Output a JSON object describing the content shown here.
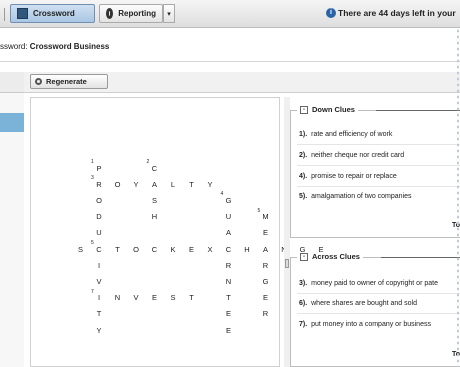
{
  "toolbar": {
    "tabs": [
      {
        "label": "Crossword",
        "icon": "crossword-grid-icon"
      },
      {
        "label": "Reporting",
        "icon": "reporting-gear-icon"
      }
    ],
    "dropdown_glyph": "▾",
    "trial_notice": "There are 44 days left in your"
  },
  "crossword": {
    "title_label": "ssword:",
    "title_value": "Crossword Business",
    "regenerate_label": "Regenerate"
  },
  "grid": {
    "cells": [
      {
        "c": "P",
        "n": "1"
      },
      {
        "c": "R",
        "n": "3"
      },
      {
        "c": "O"
      },
      {
        "c": "D"
      },
      {
        "c": "U"
      },
      {
        "c": "C",
        "n": "5"
      },
      {
        "c": "I"
      },
      {
        "c": "V"
      },
      {
        "c": "I",
        "n": "7"
      },
      {
        "c": "T"
      },
      {
        "c": "Y"
      },
      {
        "c": "O"
      },
      {
        "c": "Y"
      },
      {
        "c": "A"
      },
      {
        "c": "L"
      },
      {
        "c": "T"
      },
      {
        "c": "Y"
      },
      {
        "c": "C",
        "n": "2"
      },
      {
        "c": "S"
      },
      {
        "c": "H"
      },
      {
        "c": "S"
      },
      {
        "c": "T"
      },
      {
        "c": "O"
      },
      {
        "c": "C"
      },
      {
        "c": "K"
      },
      {
        "c": "E"
      },
      {
        "c": "X"
      },
      {
        "c": "C"
      },
      {
        "c": "H"
      },
      {
        "c": "A"
      },
      {
        "c": "N"
      },
      {
        "c": "G"
      },
      {
        "c": "E"
      },
      {
        "c": "G",
        "n": "4"
      },
      {
        "c": "U"
      },
      {
        "c": "A"
      },
      {
        "c": "R"
      },
      {
        "c": "N"
      },
      {
        "c": "T"
      },
      {
        "c": "E"
      },
      {
        "c": "E"
      },
      {
        "c": "M",
        "n": "5"
      },
      {
        "c": "E"
      },
      {
        "c": "R"
      },
      {
        "c": "G"
      },
      {
        "c": "E"
      },
      {
        "c": "R"
      },
      {
        "c": "N"
      },
      {
        "c": "V"
      },
      {
        "c": "E"
      },
      {
        "c": "S"
      },
      {
        "c": "T"
      }
    ]
  },
  "down_clues": {
    "heading": "Down Clues",
    "items": [
      {
        "num": "1).",
        "text": "rate and efficiency of work"
      },
      {
        "num": "2).",
        "text": "neither cheque nor credit card"
      },
      {
        "num": "4).",
        "text": "promise to repair or replace"
      },
      {
        "num": "5).",
        "text": "amalgamation of two companies"
      }
    ],
    "footer": "To"
  },
  "across_clues": {
    "heading": "Across Clues",
    "items": [
      {
        "num": "3).",
        "text": "money paid to owner of copyright or pate"
      },
      {
        "num": "6).",
        "text": "where shares are bought and sold"
      },
      {
        "num": "7).",
        "text": "put money into a company or business"
      }
    ],
    "footer": "To"
  },
  "colors": {
    "active_tab": "#a9c6e3",
    "nav_selected": "#7bb2d8",
    "info_icon": "#2a63a8"
  }
}
